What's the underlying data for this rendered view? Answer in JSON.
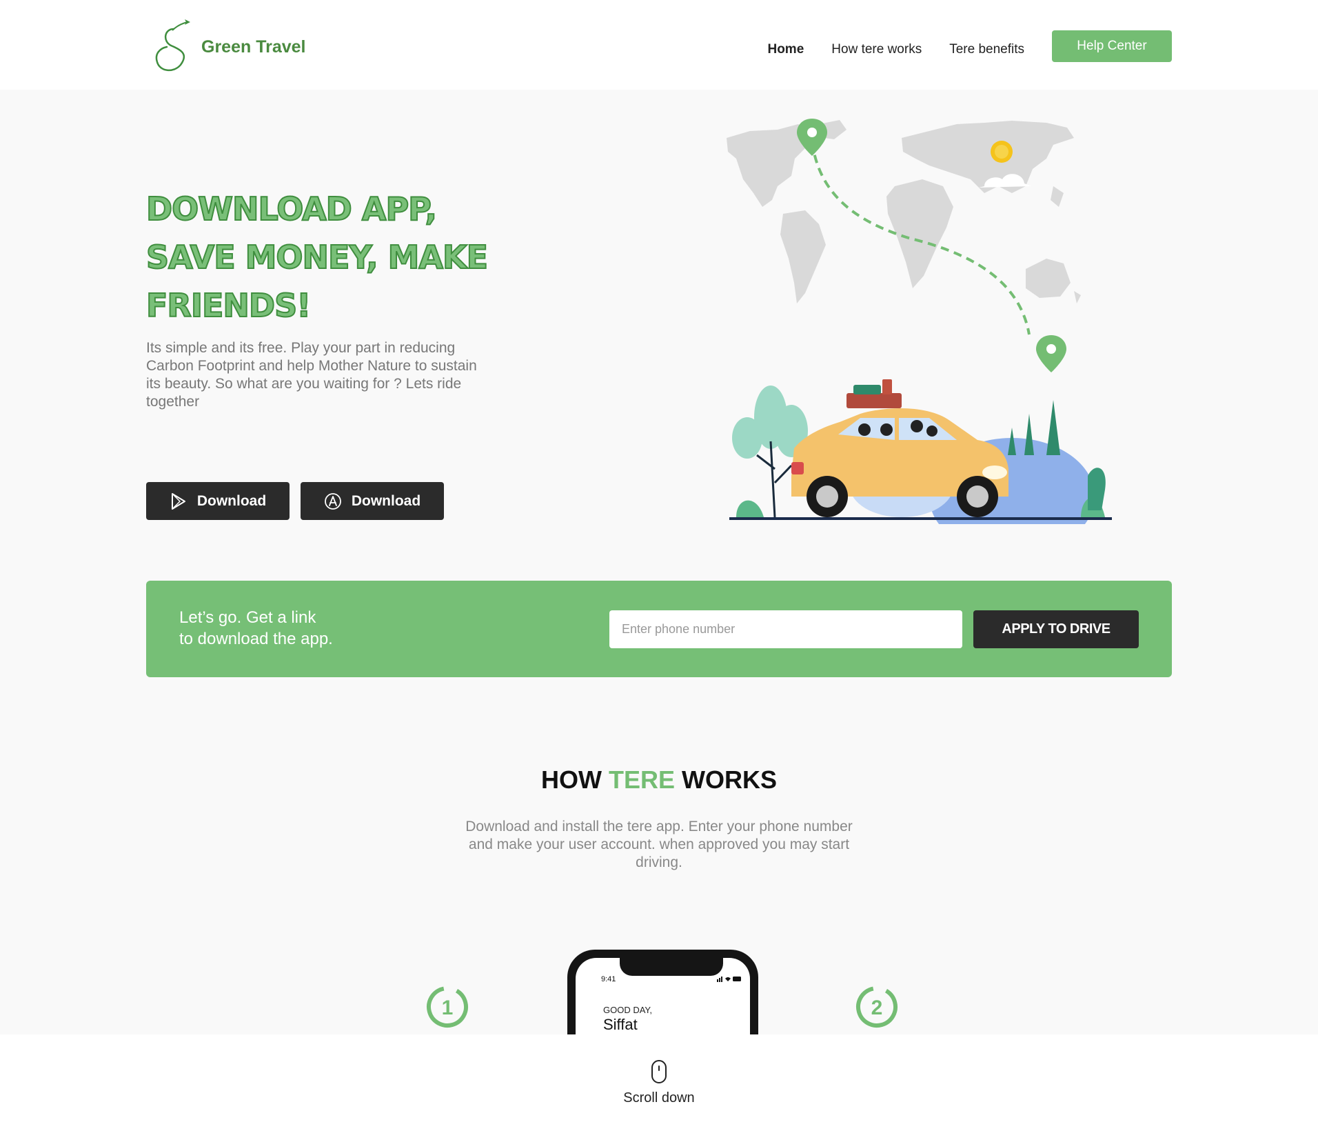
{
  "brand": {
    "name": "Green Travel",
    "accent_color": "#74bd73",
    "dark_color": "#2b2b2b"
  },
  "nav": {
    "items": [
      {
        "label": "Home",
        "active": true
      },
      {
        "label": "How tere works",
        "active": false
      },
      {
        "label": "Tere benefits",
        "active": false
      }
    ],
    "cta_label": "Help Center"
  },
  "hero": {
    "title_lines": [
      "DOWNLOAD APP,",
      "SAVE MONEY, MAKE",
      "FRIENDS!"
    ],
    "description": "Its simple and its free. Play your part in reducing Carbon Footprint and help Mother Nature to sustain its beauty. So what are you waiting for ? Lets ride together",
    "buttons": [
      {
        "label": "Download",
        "icon": "play-store-icon"
      },
      {
        "label": "Download",
        "icon": "app-store-icon"
      }
    ]
  },
  "signup": {
    "line1": "Let’s go. Get a link",
    "line2": "to download the app.",
    "phone_placeholder": "Enter phone number",
    "apply_label": "APPLY TO DRIVE"
  },
  "how": {
    "title_prefix": "HOW",
    "title_accent": "TERE",
    "title_suffix": "WORKS",
    "description": "Download and install the tere app. Enter your phone number and make your user account. when approved you may start driving.",
    "steps": [
      "1",
      "2"
    ],
    "phone": {
      "time": "9:41",
      "greeting": "GOOD DAY,",
      "name": "Siffat"
    }
  },
  "scroll": {
    "label": "Scroll down"
  }
}
